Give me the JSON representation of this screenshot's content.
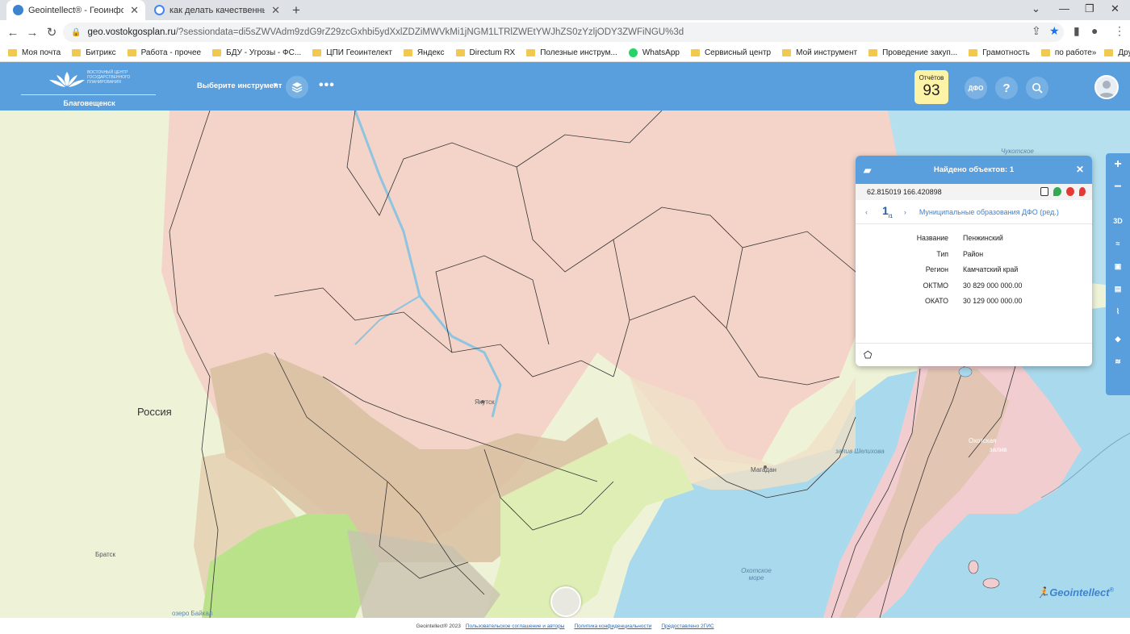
{
  "browser": {
    "tabs": [
      {
        "label": "Geointellect® - Геоинформаци",
        "favicon": "globe-icon"
      },
      {
        "label": "как делать качественные сним",
        "favicon": "google-icon"
      }
    ],
    "url_main": "geo.vostokgosplan.ru",
    "url_rest": "/?sessiondata=di5sZWVAdm9zdG9rZ29zcGxhbi5ydXxlZDZiMWVkMi1jNGM1LTRlZWEtYWJhZS0zYzljODY3ZWFiNGU%3d",
    "bookmarks": [
      "Моя почта",
      "Битрикс",
      "Работа - прочее",
      "БДУ - Угрозы - ФС...",
      "ЦПИ Геоинтелект",
      "Яндекс",
      "Directum RX",
      "Полезные инструм...",
      "WhatsApp",
      "Сервисный центр",
      "Мой инструмент",
      "Проведение закуп...",
      "Грамотность",
      "по работе"
    ],
    "bookmarks_more": "»",
    "other_bookmarks": "Другие закладки"
  },
  "app": {
    "logo_text": "ВОСТОЧНЫЙ ЦЕНТР ГОСУДАРСТВЕННОГО ПЛАНИРОВАНИЯ",
    "city": "Благовещенск",
    "tool_select": "Выберите инструмент",
    "dots": "•••",
    "reports_label": "Отчётов",
    "reports_count": "93",
    "dfo_label": "ДФО"
  },
  "map": {
    "country_label": "Россия",
    "labels": [
      "Якутск",
      "Магадан",
      "залив Шелихова",
      "Охотское море",
      "Братск",
      "озеро Байкал",
      "Чукотское",
      "Охотская",
      "залив"
    ],
    "brand": "Geointellect"
  },
  "popup": {
    "title": "Найдено объектов: 1",
    "coords": "62.815019 166.420898",
    "page_current": "1",
    "page_total": "/1",
    "layer_link": "Муниципальные образования ДФО (ред.)",
    "props": [
      {
        "key": "Название",
        "value": "Пенжинский"
      },
      {
        "key": "Тип",
        "value": "Район"
      },
      {
        "key": "Регион",
        "value": "Камчатский край"
      },
      {
        "key": "ОКТМО",
        "value": "30 829 000 000.00"
      },
      {
        "key": "ОКАТО",
        "value": "30 129 000 000.00"
      }
    ]
  },
  "footer": {
    "copyright": "Geointellect® 2023",
    "links": [
      "Пользовательское соглашение и авторы",
      "Политика конфиденциальности",
      "Предоставлено 2ГИС"
    ]
  }
}
